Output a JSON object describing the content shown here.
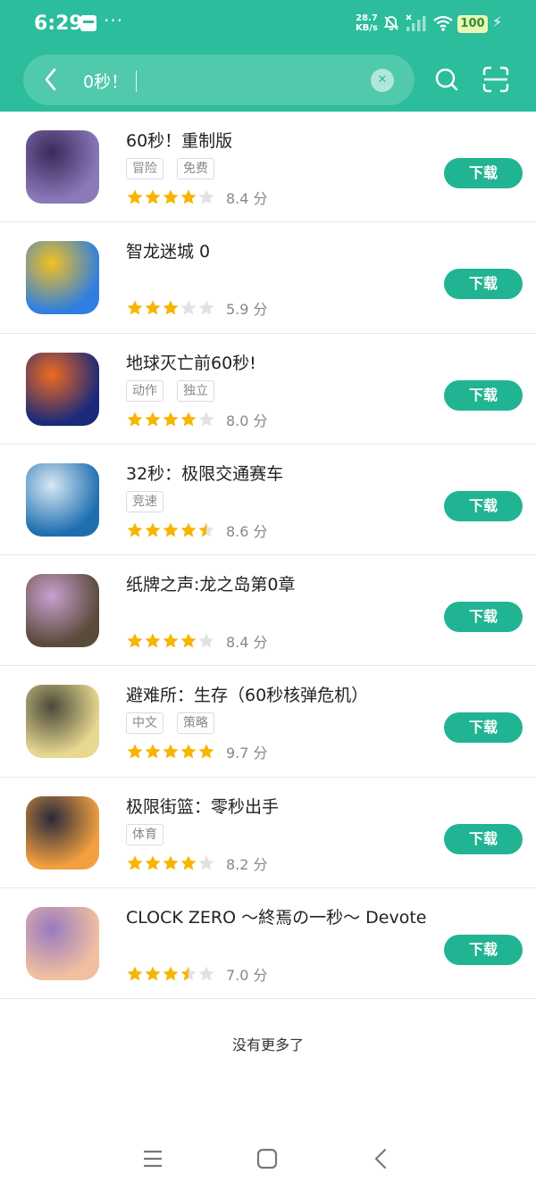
{
  "status_bar": {
    "time": "6:29",
    "more": "···",
    "net_speed_value": "28.7",
    "net_speed_unit": "KB/s",
    "battery": "100"
  },
  "search": {
    "query": "0秒！"
  },
  "apps": [
    {
      "name": "60秒！重制版",
      "tags": [
        "冒险",
        "免费"
      ],
      "rating": 8.4,
      "stars": 4,
      "score": "8.4 分",
      "button": "下载",
      "icon_colors": [
        "#8b79b9",
        "#3a2a5a"
      ]
    },
    {
      "name": "智龙迷城 0",
      "tags": [],
      "rating": 5.9,
      "stars": 3,
      "score": "5.9 分",
      "button": "下载",
      "icon_colors": [
        "#2f7fe0",
        "#f4c020"
      ]
    },
    {
      "name": "地球灭亡前60秒!",
      "tags": [
        "动作",
        "独立"
      ],
      "rating": 8.0,
      "stars": 4,
      "score": "8.0 分",
      "button": "下载",
      "icon_colors": [
        "#1b2a7a",
        "#f06a20"
      ]
    },
    {
      "name": "32秒：极限交通赛车",
      "tags": [
        "竞速"
      ],
      "rating": 8.6,
      "stars": 4.5,
      "score": "8.6 分",
      "button": "下载",
      "icon_colors": [
        "#1f6fb0",
        "#d8e8f4"
      ]
    },
    {
      "name": "纸牌之声:龙之岛第0章",
      "tags": [],
      "rating": 8.4,
      "stars": 4,
      "score": "8.4 分",
      "button": "下载",
      "icon_colors": [
        "#5a4a3a",
        "#c9a0d0"
      ]
    },
    {
      "name": "避难所：生存（60秒核弹危机）",
      "tags": [
        "中文",
        "策略"
      ],
      "rating": 9.7,
      "stars": 5,
      "score": "9.7 分",
      "button": "下载",
      "icon_colors": [
        "#e8d890",
        "#4a4a3a"
      ]
    },
    {
      "name": "极限街篮：零秒出手",
      "tags": [
        "体育"
      ],
      "rating": 8.2,
      "stars": 4,
      "score": "8.2 分",
      "button": "下载",
      "icon_colors": [
        "#f2a040",
        "#2a2a3a"
      ]
    },
    {
      "name": "CLOCK ZERO ～終焉の一秒～ Devote",
      "tags": [],
      "rating": 7.0,
      "stars": 3.5,
      "score": "7.0 分",
      "button": "下载",
      "icon_colors": [
        "#f0c0a0",
        "#9a7ac0"
      ]
    }
  ],
  "footer": {
    "no_more": "没有更多了"
  },
  "colors": {
    "accent": "#2bbd9c",
    "button": "#21b493",
    "star_on": "#f7b500",
    "star_off": "#e2e2e2"
  }
}
